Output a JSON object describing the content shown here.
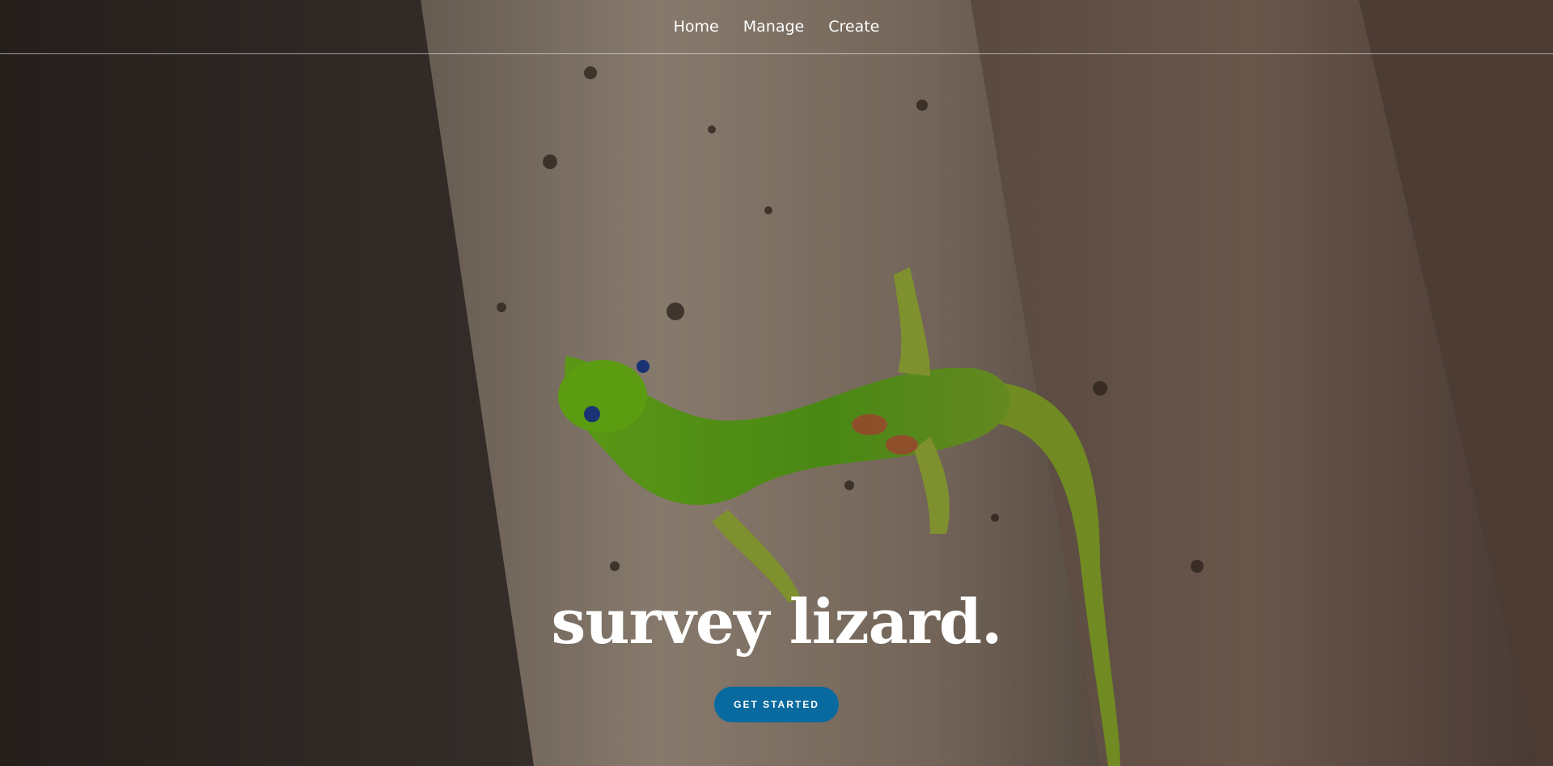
{
  "nav": {
    "items": [
      {
        "label": "Home"
      },
      {
        "label": "Manage"
      },
      {
        "label": "Create"
      }
    ]
  },
  "hero": {
    "title": "survey lizard.",
    "cta_label": "GET STARTED"
  },
  "colors": {
    "accent": "#086a9e"
  }
}
